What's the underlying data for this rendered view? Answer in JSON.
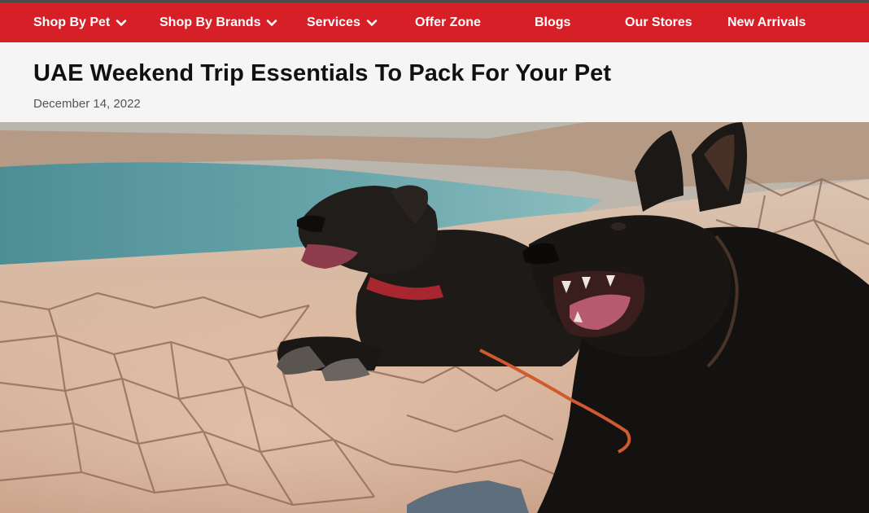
{
  "nav": {
    "items": [
      {
        "label": "Shop By Pet",
        "dropdown": true
      },
      {
        "label": "Shop By Brands",
        "dropdown": true
      },
      {
        "label": "Services",
        "dropdown": true
      },
      {
        "label": "Offer Zone",
        "dropdown": false
      },
      {
        "label": "Blogs",
        "dropdown": false
      },
      {
        "label": "Our Stores",
        "dropdown": false
      },
      {
        "label": "New Arrivals",
        "dropdown": false
      }
    ],
    "background_color": "#d71f28",
    "text_color": "#ffffff"
  },
  "article": {
    "title": "UAE Weekend Trip Essentials To Pack For Your Pet",
    "date": "December 14, 2022"
  },
  "hero_image": {
    "subject": "two-black-dogs-lying-on-cracked-earth-by-lake",
    "icon": "photo"
  }
}
